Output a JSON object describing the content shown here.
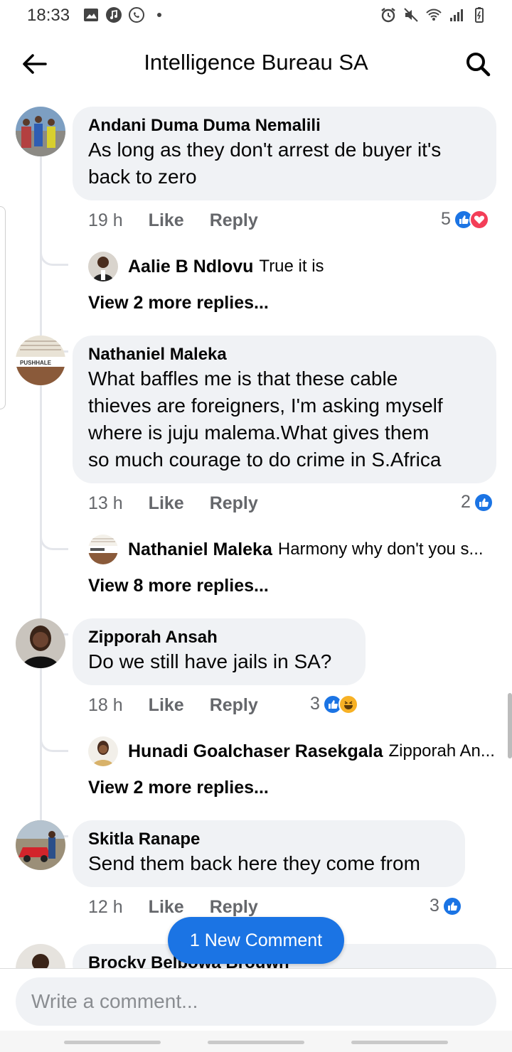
{
  "status_bar": {
    "time": "18:33",
    "left_icons": [
      "gallery-icon",
      "music-icon",
      "whatsapp-icon",
      "dot-icon"
    ],
    "right_icons": [
      "alarm-icon",
      "mute-icon",
      "wifi-icon",
      "signal-icon",
      "battery-icon"
    ]
  },
  "header": {
    "title": "Intelligence Bureau SA",
    "back_icon": "back-arrow-icon",
    "search_icon": "search-icon"
  },
  "comments": [
    {
      "author": "Andani Duma Duma Nemalili",
      "text_lines": [
        "As long as they don't arrest de buyer it's",
        "back to zero"
      ],
      "time": "19 h",
      "like_label": "Like",
      "reply_label": "Reply",
      "reaction_count": "5",
      "reactions": [
        "like",
        "love"
      ],
      "reply_preview": {
        "author": "Aalie B Ndlovu",
        "text": "True it is"
      },
      "view_more": "View 2 more replies..."
    },
    {
      "author": "Nathaniel Maleka",
      "text_lines": [
        "What baffles me is that these cable",
        "thieves are foreigners, I'm asking myself",
        "where is juju malema.What gives them",
        "so much courage to do crime in S.Africa"
      ],
      "time": "13 h",
      "like_label": "Like",
      "reply_label": "Reply",
      "reaction_count": "2",
      "reactions": [
        "like"
      ],
      "avatar_text": "PUSHHALE",
      "reply_preview": {
        "author": "Nathaniel Maleka",
        "text": "Harmony why don't you s..."
      },
      "view_more": "View 8 more replies..."
    },
    {
      "author": "Zipporah Ansah",
      "text_lines": [
        "Do we still have jails in SA?"
      ],
      "time": "18 h",
      "like_label": "Like",
      "reply_label": "Reply",
      "reaction_count": "3",
      "reactions": [
        "like",
        "haha"
      ],
      "reply_preview": {
        "author": "Hunadi Goalchaser Rasekgala",
        "text": "Zipporah An..."
      },
      "view_more": "View 2 more replies..."
    },
    {
      "author": "Skitla Ranape",
      "text_lines": [
        "Send them back here they come from"
      ],
      "time": "12 h",
      "like_label": "Like",
      "reply_label": "Reply",
      "reaction_count": "3",
      "reactions": [
        "like"
      ]
    },
    {
      "author": "Brocky Belbowa Brouwn"
    }
  ],
  "new_comment_pill": "1 New Comment",
  "composer": {
    "placeholder": "Write a comment..."
  },
  "colors": {
    "accent": "#1b74e4",
    "bubble": "#f0f2f5",
    "secondary_text": "#65676b",
    "love": "#f33e58",
    "haha": "#f7b125"
  }
}
